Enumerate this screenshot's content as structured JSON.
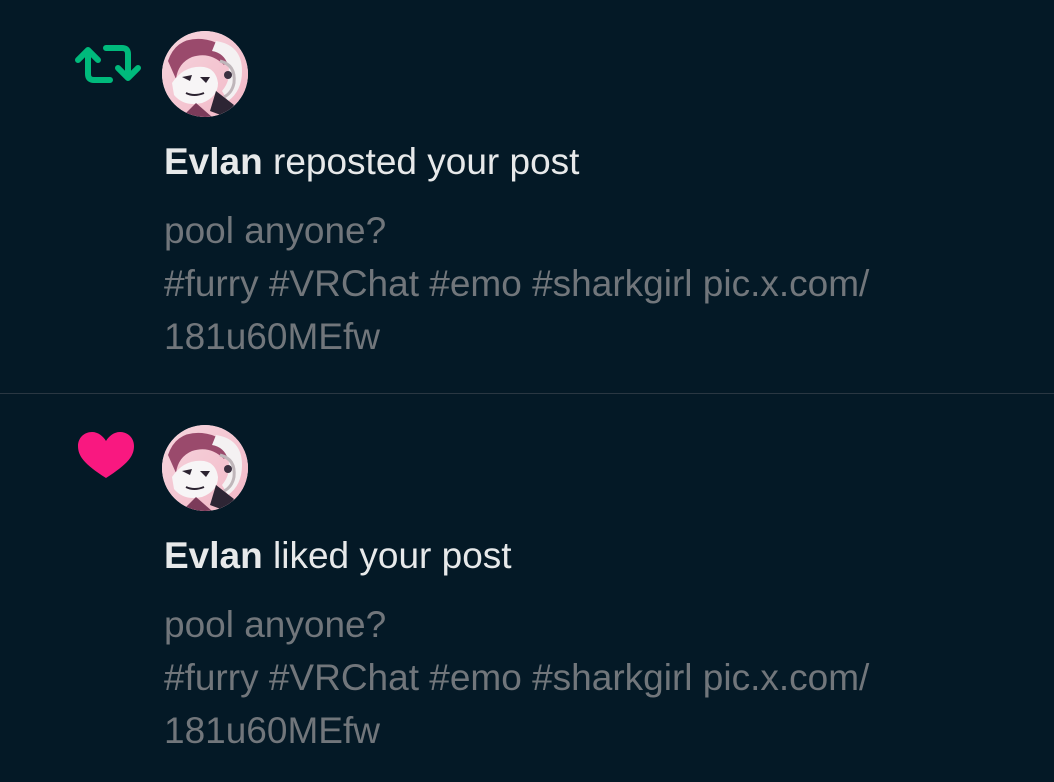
{
  "notifications": [
    {
      "type": "repost",
      "icon": "repost-icon",
      "icon_color": "#00ba7c",
      "user_name": "Evlan",
      "action": "reposted your post",
      "post_lines": [
        "pool anyone?",
        "#furry #VRChat #emo #sharkgirl pic.x.com/",
        "181u60MEfw"
      ]
    },
    {
      "type": "like",
      "icon": "heart-icon",
      "icon_color": "#f91880",
      "user_name": "Evlan",
      "action": "liked your post",
      "post_lines": [
        "pool anyone?",
        "#furry #VRChat #emo #sharkgirl pic.x.com/",
        "181u60MEfw"
      ]
    }
  ],
  "colors": {
    "background": "#041926",
    "primary_text": "#e7e9ea",
    "secondary_text": "#71767b",
    "divider": "#2a3742"
  }
}
